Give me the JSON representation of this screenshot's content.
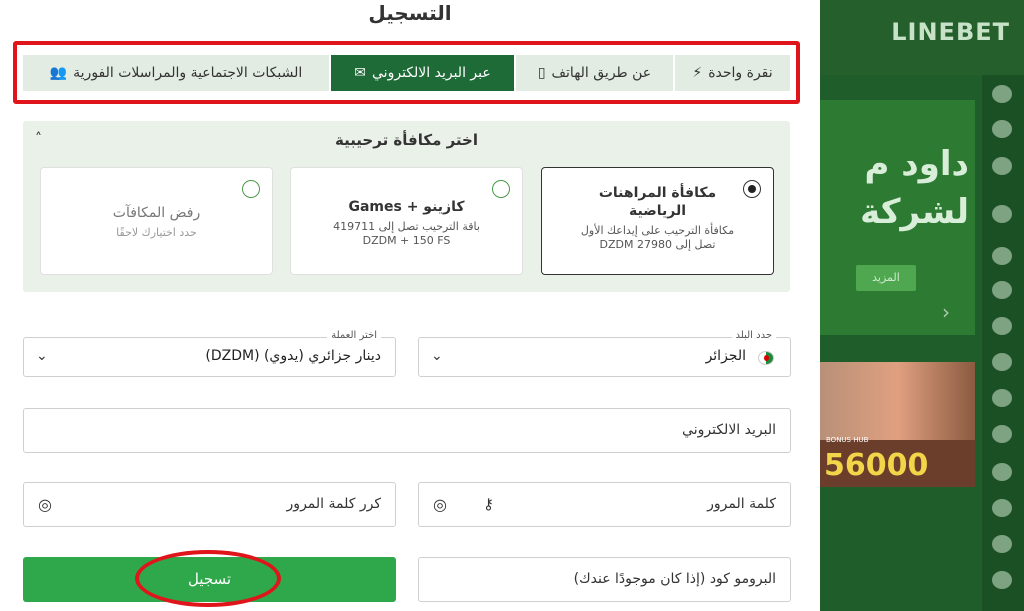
{
  "title": "التسجيل",
  "tabs": [
    {
      "label": "نقرة واحدة",
      "icon": "lightning-icon",
      "active": false
    },
    {
      "label": "عن طريق الهاتف",
      "icon": "phone-icon",
      "active": false
    },
    {
      "label": "عبر البريد الالكتروني",
      "icon": "envelope-icon",
      "active": true
    },
    {
      "label": "الشبكات الاجتماعية والمراسلات الفورية",
      "icon": "users-icon",
      "active": false
    }
  ],
  "bonus": {
    "title": "اختر مكافأة ترحيبية",
    "cards": [
      {
        "title": "مكافأة المراهنات الرياضية",
        "desc": "مكافأة الترحيب على إيداعك الأول تصل إلى 27980 DZDM",
        "selected": true
      },
      {
        "title": "كازينو + Games",
        "desc": "باقة الترحيب تصل إلى 419711 DZDM + 150 FS",
        "selected": false
      },
      {
        "title": "رفض المكافآت",
        "desc": "حدد اختيارك لاحقًا",
        "selected": false
      }
    ]
  },
  "form": {
    "country_label": "حدد البلد",
    "country_value": "الجزائر",
    "currency_label": "اختر العملة",
    "currency_value": "دينار جزائري (يدوي) (DZDM)",
    "email_placeholder": "البريد الالكتروني",
    "password_placeholder": "كلمة المرور",
    "repeat_password_placeholder": "كرر كلمة المرور",
    "promo_placeholder": "البرومو كود (إذا كان موجودًا عندك)",
    "submit_label": "تسجيل"
  },
  "background": {
    "brand": "LINEBET",
    "banner_text": "داود م لشركة",
    "banner_button": "المزيد",
    "promo_number": "56000",
    "promo_small": "BONUS HUB",
    "promo_caption": "Bonus Hub"
  },
  "colors": {
    "accent_dark": "#1e6b37",
    "accent": "#2ea84a",
    "highlight": "#e0151b"
  }
}
